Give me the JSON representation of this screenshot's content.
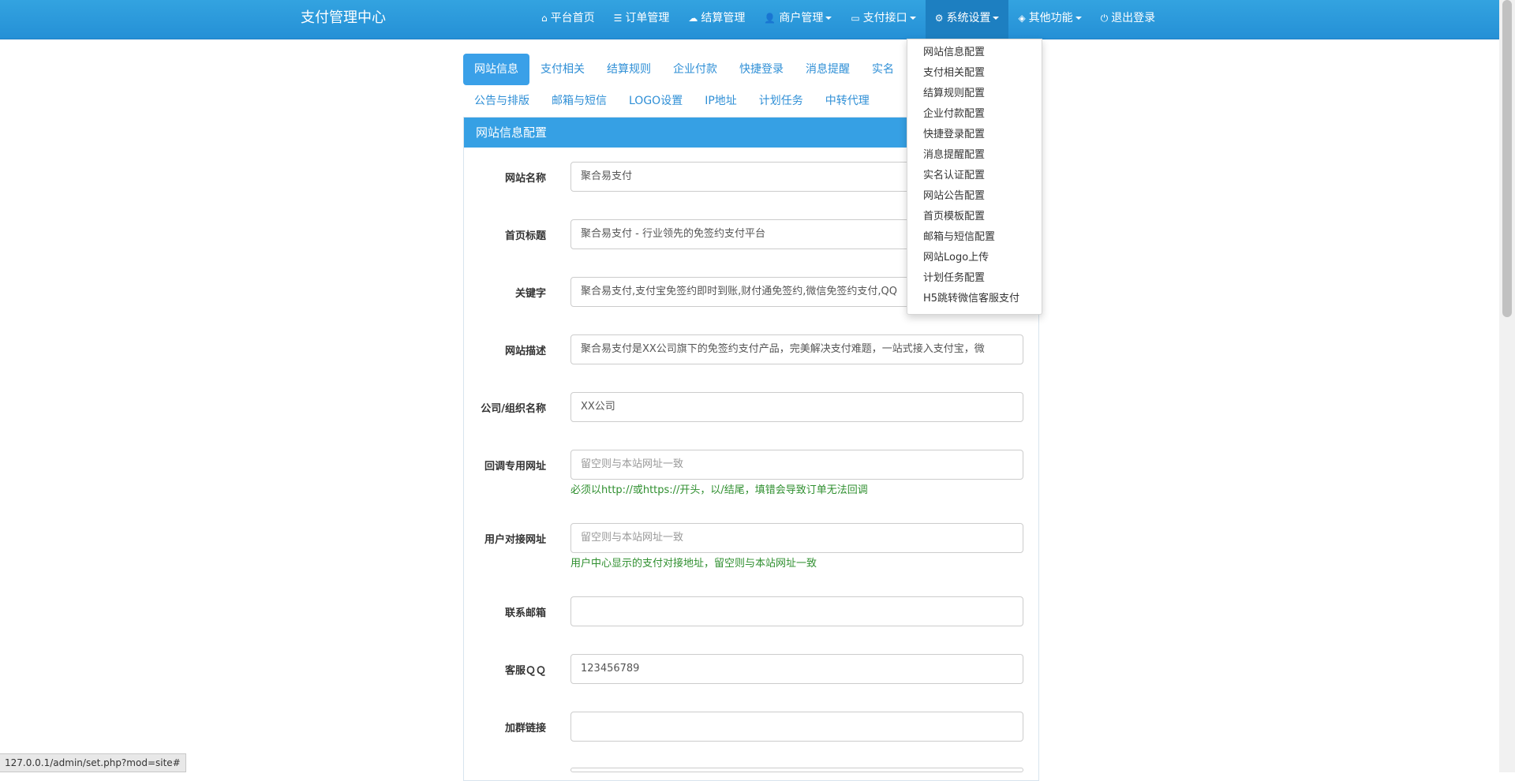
{
  "navbar": {
    "brand": "支付管理中心",
    "items": [
      {
        "icon": "home-icon",
        "glyph": "⌂",
        "label": "平台首页",
        "dropdown": false
      },
      {
        "icon": "list-icon",
        "glyph": "☰",
        "label": "订单管理",
        "dropdown": false
      },
      {
        "icon": "cloud-icon",
        "glyph": "☁",
        "label": "结算管理",
        "dropdown": false
      },
      {
        "icon": "user-icon",
        "glyph": "👤",
        "label": "商户管理",
        "dropdown": true
      },
      {
        "icon": "credit-card-icon",
        "glyph": "▭",
        "label": "支付接口",
        "dropdown": true
      },
      {
        "icon": "gear-icon",
        "glyph": "⚙",
        "label": "系统设置",
        "dropdown": true,
        "active": true
      },
      {
        "icon": "cube-icon",
        "glyph": "◈",
        "label": "其他功能",
        "dropdown": true
      },
      {
        "icon": "power-icon",
        "glyph": "⏻",
        "label": "退出登录",
        "dropdown": false
      }
    ]
  },
  "dropdown": {
    "items": [
      "网站信息配置",
      "支付相关配置",
      "结算规则配置",
      "企业付款配置",
      "快捷登录配置",
      "消息提醒配置",
      "实名认证配置",
      "网站公告配置",
      "首页模板配置",
      "邮箱与短信配置",
      "网站Logo上传",
      "计划任务配置",
      "H5跳转微信客服支付"
    ]
  },
  "tabs": {
    "row1": [
      "网站信息",
      "支付相关",
      "结算规则",
      "企业付款",
      "快捷登录",
      "消息提醒",
      "实名"
    ],
    "row2": [
      "公告与排版",
      "邮箱与短信",
      "LOGO设置",
      "IP地址",
      "计划任务",
      "中转代理"
    ]
  },
  "panel": {
    "title": "网站信息配置"
  },
  "form": {
    "site_name": {
      "label": "网站名称",
      "value": "聚合易支付"
    },
    "home_title": {
      "label": "首页标题",
      "value": "聚合易支付 - 行业领先的免签约支付平台"
    },
    "keywords": {
      "label": "关键字",
      "value": "聚合易支付,支付宝免签约即时到账,财付通免签约,微信免签约支付,QQ"
    },
    "description": {
      "label": "网站描述",
      "value": "聚合易支付是XX公司旗下的免签约支付产品，完美解决支付难题，一站式接入支付宝，微"
    },
    "company": {
      "label": "公司/组织名称",
      "value": "XX公司"
    },
    "callback_url": {
      "label": "回调专用网址",
      "placeholder": "留空则与本站网址一致",
      "help": "必须以http://或https://开头，以/结尾，填错会导致订单无法回调"
    },
    "user_url": {
      "label": "用户对接网址",
      "placeholder": "留空则与本站网址一致",
      "help": "用户中心显示的支付对接地址，留空则与本站网址一致"
    },
    "email": {
      "label": "联系邮箱",
      "value": ""
    },
    "qq": {
      "label": "客服ＱＱ",
      "value": "123456789"
    },
    "group_link": {
      "label": "加群链接",
      "value": ""
    }
  },
  "statusbar": {
    "url": "127.0.0.1/admin/set.php?mod=site#"
  }
}
